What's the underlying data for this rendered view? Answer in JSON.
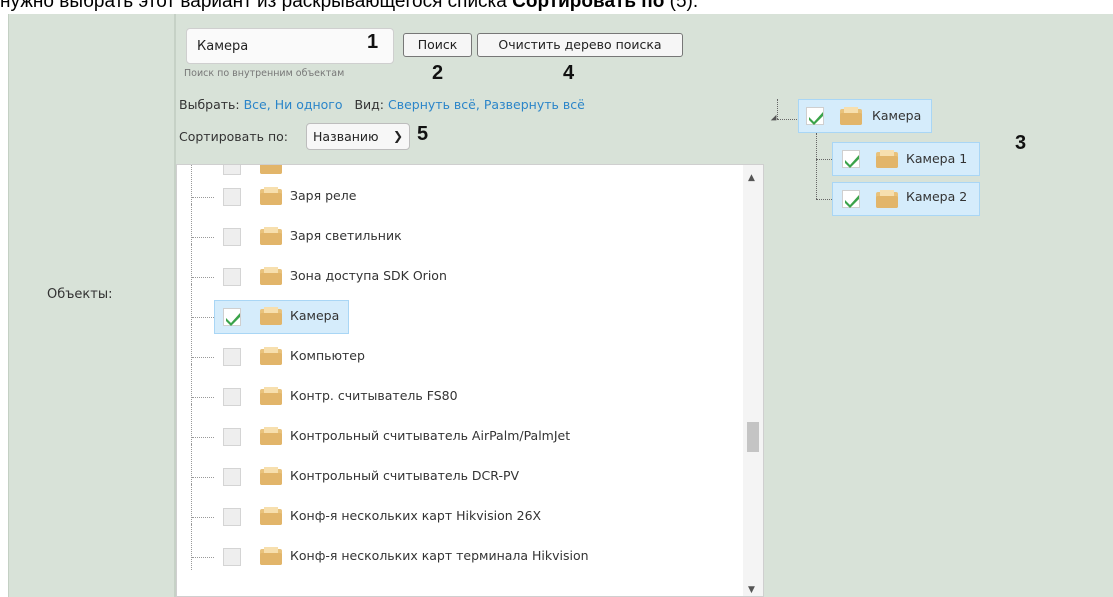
{
  "caption": {
    "prefix": "нужно выбрать этот вариант из раскрывающегося списка ",
    "bold": "Сортировать по",
    "suffix": " (5)."
  },
  "labels": {
    "objects": "Объекты:"
  },
  "search": {
    "value": "Камера",
    "hint": "Поиск по внутренним объектам",
    "search_button": "Поиск",
    "clear_button": "Очистить дерево поиска"
  },
  "callouts": {
    "n1": "1",
    "n2": "2",
    "n3": "3",
    "n4": "4",
    "n5": "5"
  },
  "select_row": {
    "select_label": "Выбрать:",
    "all": "Все,",
    "none": "Ни одного",
    "view_label": "Вид:",
    "collapse": "Свернуть всё,",
    "expand": "Развернуть всё"
  },
  "sort": {
    "label": "Сортировать по:",
    "selected": "Названию"
  },
  "list_items": [
    {
      "label": "Заря реле",
      "checked": false
    },
    {
      "label": "Заря светильник",
      "checked": false
    },
    {
      "label": "Зона доступа SDK Orion",
      "checked": false
    },
    {
      "label": "Камера",
      "checked": true
    },
    {
      "label": "Компьютер",
      "checked": false
    },
    {
      "label": "Контр. считыватель FS80",
      "checked": false
    },
    {
      "label": "Контрольный считыватель AirPalm/PalmJet",
      "checked": false
    },
    {
      "label": "Контрольный считыватель DCR-PV",
      "checked": false
    },
    {
      "label": "Конф-я нескольких карт Hikvision 26X",
      "checked": false
    },
    {
      "label": "Конф-я нескольких карт терминала Hikvision",
      "checked": false
    }
  ],
  "result_tree": {
    "root": "Камера",
    "children": [
      "Камера 1",
      "Камера 2"
    ]
  },
  "colors": {
    "panel_bg": "#d8e2d8",
    "link": "#2b85c9",
    "selected_bg": "#d5ecfb",
    "check_green": "#3aa34a"
  }
}
